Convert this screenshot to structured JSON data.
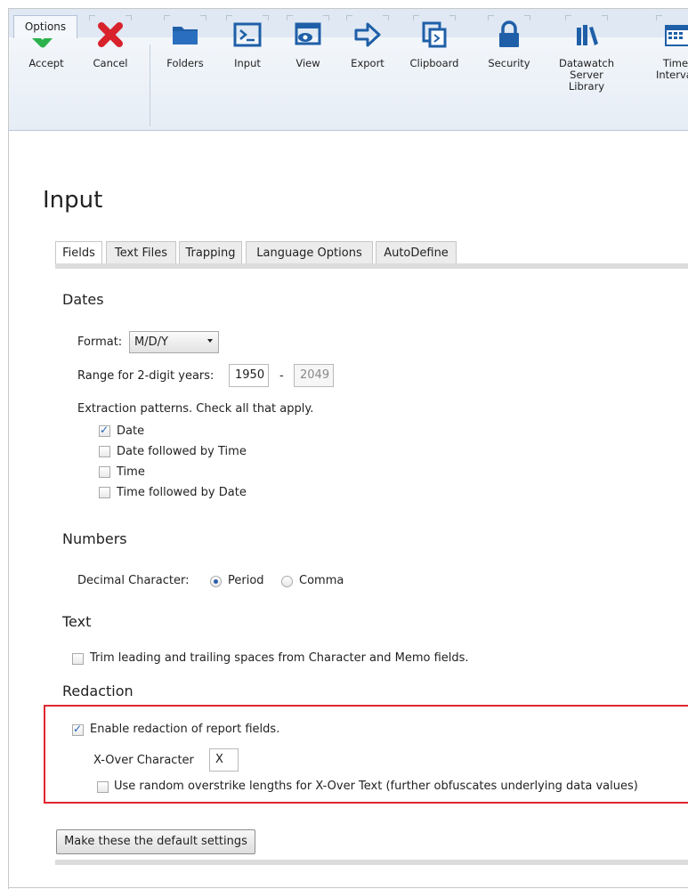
{
  "ribbon": {
    "tab_label": "Options",
    "buttons": [
      {
        "label": "Accept",
        "icon": "checkmark-icon"
      },
      {
        "label": "Cancel",
        "icon": "x-icon"
      },
      {
        "label": "Folders",
        "icon": "folder-icon"
      },
      {
        "label": "Input",
        "icon": "terminal-icon"
      },
      {
        "label": "View",
        "icon": "view-icon"
      },
      {
        "label": "Export",
        "icon": "arrow-right-icon"
      },
      {
        "label": "Clipboard",
        "icon": "clipboard-icon"
      },
      {
        "label": "Security",
        "icon": "lock-icon"
      },
      {
        "label": "Datawatch Server Library",
        "icon": "library-icon"
      },
      {
        "label": "Time Interval",
        "icon": "calendar-icon"
      }
    ],
    "accent_green": "#2bb24c",
    "accent_red": "#d8222c",
    "accent_blue": "#1f5fa8"
  },
  "page": {
    "title": "Input",
    "tabs": [
      "Fields",
      "Text Files",
      "Trapping",
      "Language Options",
      "AutoDefine"
    ],
    "active_tab": "Fields"
  },
  "dates": {
    "heading": "Dates",
    "format_label": "Format:",
    "format_value": "M/D/Y",
    "range_label": "Range for 2-digit years:",
    "range_start": "1950",
    "range_separator": "-",
    "range_end": "2049",
    "extraction_label": "Extraction patterns. Check all that apply.",
    "patterns": [
      {
        "label": "Date",
        "checked": true
      },
      {
        "label": "Date followed by Time",
        "checked": false
      },
      {
        "label": "Time",
        "checked": false
      },
      {
        "label": "Time followed by Date",
        "checked": false
      }
    ]
  },
  "numbers": {
    "heading": "Numbers",
    "decimal_label": "Decimal Character:",
    "options": [
      {
        "label": "Period",
        "selected": true
      },
      {
        "label": "Comma",
        "selected": false
      }
    ]
  },
  "text": {
    "heading": "Text",
    "trim_label": "Trim leading and trailing spaces from Character and Memo fields.",
    "trim_checked": false
  },
  "redaction": {
    "heading": "Redaction",
    "enable_label": "Enable redaction of report fields.",
    "enable_checked": true,
    "xover_label": "X-Over Character",
    "xover_value": "X",
    "random_label": "Use random overstrike lengths for X-Over Text (further obfuscates underlying data values)",
    "random_checked": false,
    "highlight_color": "#e0262e"
  },
  "footer": {
    "default_button": "Make these the default settings"
  }
}
